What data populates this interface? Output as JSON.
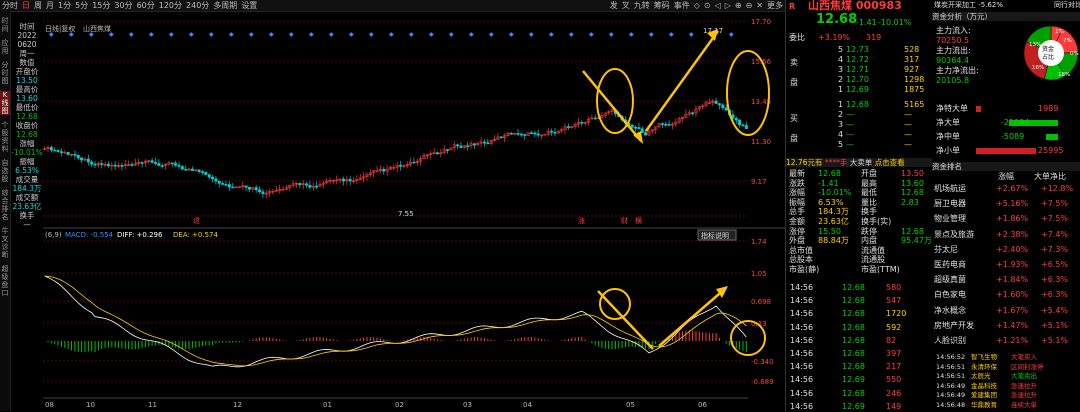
{
  "toolbar": {
    "items": [
      "分时",
      "日",
      "周",
      "月",
      "1分",
      "5分",
      "15分",
      "30分",
      "60分",
      "120分",
      "240分",
      "多周期",
      "设置"
    ],
    "active_index": 1,
    "right_items": [
      "发",
      "叉",
      "九转",
      "筹码",
      "事件",
      "◇",
      "⊙",
      "◁",
      "▷",
      "⊕",
      "⊖",
      "✕",
      "更多"
    ]
  },
  "left_tabs": [
    "时间",
    "应用",
    "分时图",
    "K线图",
    "个股资料",
    "自选股",
    "综合排名",
    "牛叉诊断",
    "超级盘口"
  ],
  "info": {
    "labels": [
      "时间",
      "2022",
      "0620",
      "周一",
      "数值",
      "开盘价",
      "13.50",
      "最高价",
      "13.60",
      "最低价",
      "12.68",
      "收盘价",
      "12.68",
      "涨幅",
      "-10.01%",
      "振幅",
      "6.53%",
      "成交量",
      "184.3万",
      "成交额",
      "23.63亿",
      "换手",
      "—"
    ]
  },
  "chart": {
    "stock_label": "日线|复权",
    "stock_name": "山西焦煤",
    "price_ticks": [
      "17.70",
      "15.56",
      "13.45",
      "11.30",
      "9.17",
      "7.55"
    ],
    "high_label": "17.17",
    "low_label": "7.55",
    "markers": [
      "退",
      "涨",
      "财",
      "横"
    ],
    "macd_header": "(6,9)",
    "macd_label": "MACD: -0.554",
    "diff_label": "DIFF: +0.296",
    "dea_label": "DEA: +0.574",
    "macd_btn": "指标说明",
    "macd_ticks": [
      "1.74",
      "1.05",
      "0.698",
      "0.33",
      "-0.340",
      "-0.689"
    ],
    "x_labels": [
      "08",
      "10",
      "11",
      "12",
      "01",
      "02",
      "03",
      "04",
      "05",
      "06"
    ]
  },
  "chart_data": {
    "type": "candlestick",
    "title": "山西焦煤",
    "ylabel": "",
    "ylim": [
      7.55,
      17.7
    ],
    "x_months": [
      "08",
      "10",
      "11",
      "12",
      "01",
      "02",
      "03",
      "04",
      "05",
      "06"
    ],
    "price_high": 17.17,
    "price_low": 7.55
  },
  "quote": {
    "flag": "R",
    "name": "山西焦煤 000983",
    "price": "12.68",
    "change": "-1.41",
    "pct": "-10.01%",
    "weibi_label": "委比",
    "weibi": "+3.19%",
    "weibi_n": "319",
    "sell_label": "卖",
    "buy_label": "买",
    "pan_label": "盘",
    "asks": [
      [
        "5",
        "12.73",
        "528"
      ],
      [
        "4",
        "12.72",
        "317"
      ],
      [
        "3",
        "12.71",
        "927"
      ],
      [
        "2",
        "12.70",
        "1298"
      ],
      [
        "1",
        "12.69",
        "1875"
      ]
    ],
    "bids": [
      [
        "1",
        "12.68",
        "5165"
      ],
      [
        "2",
        "—",
        "—"
      ],
      [
        "3",
        "—",
        "—"
      ],
      [
        "4",
        "—",
        "—"
      ],
      [
        "5",
        "—",
        "—"
      ]
    ]
  },
  "fund": {
    "header": "资金分析（万元）",
    "top_info": "煤炭开采加工  -5.62%",
    "top_right": "同行对比",
    "rows": [
      [
        "主力流入",
        "70250.5"
      ],
      [
        "主力流出",
        "90364.4"
      ],
      [
        "主力净流出",
        "20105.8"
      ]
    ],
    "pie_center": "资金占比",
    "pie_pcts": [
      "1%",
      "7%",
      "0%",
      "18%",
      "16%",
      "13%"
    ],
    "net_label": "净特大单",
    "net_big_label": "净大单",
    "net_mid_label": "净中单",
    "net_small_label": "净小单",
    "net_vals": [
      "1989",
      "-21094",
      "-5089",
      "25995"
    ]
  },
  "trade": {
    "header_a": "12.76元有",
    "header_b": "****手",
    "header_c": "大卖单",
    "header_d": "点击查看",
    "rows": [
      [
        "最新",
        "12.68",
        "开盘",
        "13.50"
      ],
      [
        "涨跌",
        "-1.41",
        "最高",
        "13.60"
      ],
      [
        "涨幅",
        "-10.01%",
        "最低",
        "12.68"
      ],
      [
        "振幅",
        "6.53%",
        "量比",
        "2.83"
      ],
      [
        "总手",
        "184.3万",
        "换手",
        ""
      ],
      [
        "金额",
        "23.63亿",
        "换手(实)",
        ""
      ],
      [
        "涨停",
        "15.50",
        "跌停",
        "12.68"
      ],
      [
        "外盘",
        "88.84万",
        "内盘",
        "95.47万"
      ],
      [
        "总市值",
        "",
        "流通值",
        ""
      ],
      [
        "总股本",
        "",
        "流通股",
        ""
      ],
      [
        "市盈(静)",
        "",
        "市盈(TTM)",
        ""
      ]
    ]
  },
  "sector": {
    "header": "资金排名",
    "cols": [
      "",
      "涨幅",
      "大单净比"
    ],
    "rows": [
      [
        "机场航运",
        "+2.67%",
        "+12.8%"
      ],
      [
        "厨卫电器",
        "+5.16%",
        "+7.5%"
      ],
      [
        "物业管理",
        "+1.86%",
        "+7.5%"
      ],
      [
        "景点及旅游",
        "+2.38%",
        "+7.4%"
      ],
      [
        "芬太尼",
        "+2.40%",
        "+7.3%"
      ],
      [
        "医药电商",
        "+1.93%",
        "+6.5%"
      ],
      [
        "超级真菌",
        "+1.84%",
        "+6.3%"
      ],
      [
        "白色家电",
        "+1.60%",
        "+6.3%"
      ],
      [
        "净水概念",
        "+1.67%",
        "+5.4%"
      ],
      [
        "房地产开发",
        "+1.47%",
        "+5.1%"
      ],
      [
        "人脸识别",
        "+1.21%",
        "+5.1%"
      ]
    ]
  },
  "ticks": {
    "rows": [
      [
        "14:56",
        "12.68",
        "580"
      ],
      [
        "14:56",
        "12.68",
        "547"
      ],
      [
        "14:56",
        "12.68",
        "1720"
      ],
      [
        "14:56",
        "12.68",
        "592"
      ],
      [
        "14:56",
        "12.68",
        "82"
      ],
      [
        "14:56",
        "12.68",
        "397"
      ],
      [
        "14:56",
        "12.68",
        "217"
      ],
      [
        "14:56",
        "12.69",
        "550"
      ],
      [
        "14:56",
        "12.68",
        "246"
      ],
      [
        "14:56",
        "12.69",
        "149"
      ]
    ]
  },
  "news": {
    "rows": [
      [
        "14:56:52",
        "智飞生物",
        "大笔买入"
      ],
      [
        "14:56:51",
        "永清环保",
        "区间封涨停"
      ],
      [
        "14:56:51",
        "太辰光",
        "大笔卖出"
      ],
      [
        "14:56:49",
        "金晶科技",
        "急速拉升"
      ],
      [
        "14:56:49",
        "爱建集团",
        "急速拉升"
      ],
      [
        "14:56:48",
        "华鼎教育",
        "连续大单"
      ]
    ]
  },
  "colors": {
    "up": "#ff3b3b",
    "down": "#00d0d0",
    "grid": "#5a0a0a",
    "circle": "#ffc20a"
  }
}
